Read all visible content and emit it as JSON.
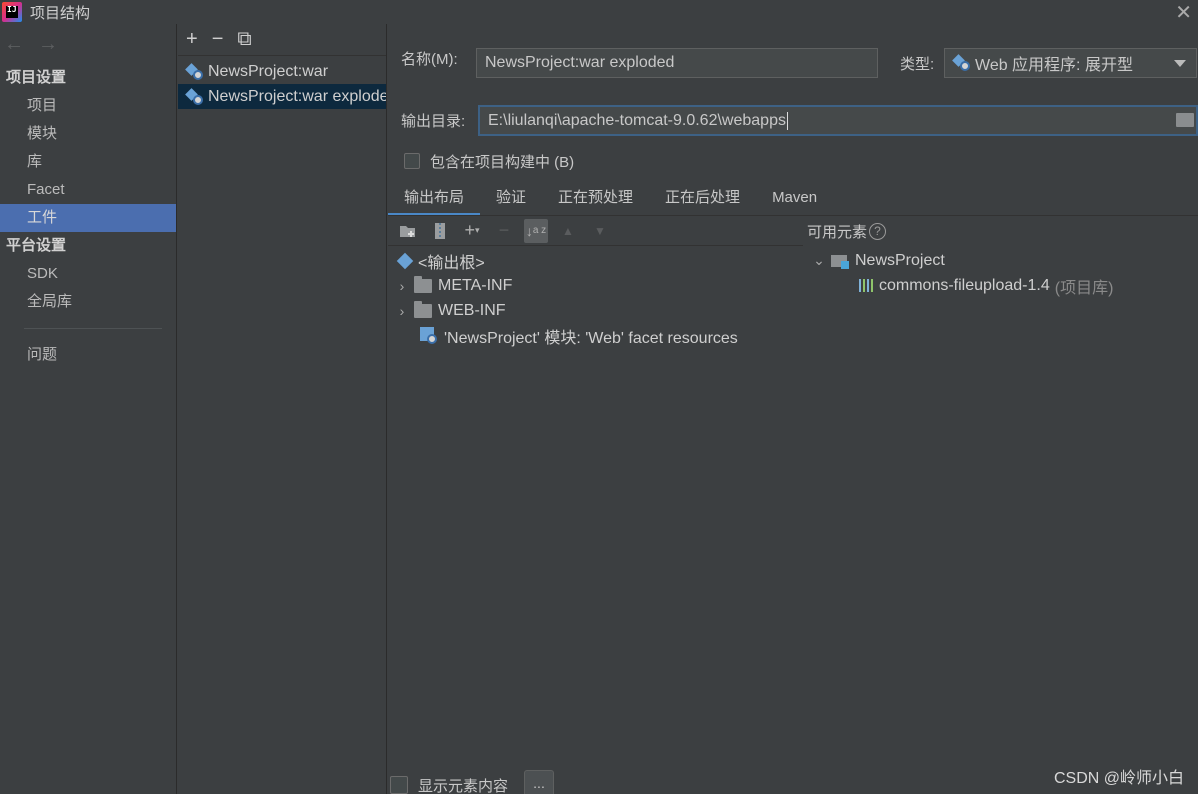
{
  "window": {
    "title": "项目结构",
    "app_icon_text": "IJ"
  },
  "nav": {
    "back": "←",
    "forward": "→",
    "project_settings": "项目设置",
    "project_items": [
      "项目",
      "模块",
      "库",
      "Facet",
      "工件"
    ],
    "platform_settings": "平台设置",
    "platform_items": [
      "SDK",
      "全局库"
    ],
    "problems": "问题"
  },
  "artifacts": {
    "toolbar": {
      "add": "+",
      "remove": "−",
      "copy": "⧉"
    },
    "items": [
      "NewsProject:war",
      "NewsProject:war exploded"
    ]
  },
  "form": {
    "name_label": "名称(M):",
    "name_value": "NewsProject:war exploded",
    "type_label": "类型:",
    "type_value": "Web 应用程序: 展开型",
    "output_label": "输出目录:",
    "output_value": "E:\\liulanqi\\apache-tomcat-9.0.62\\webapps",
    "include_in_build": "包含在项目构建中 (B)"
  },
  "tabs": [
    "输出布局",
    "验证",
    "正在预处理",
    "正在后处理",
    "Maven"
  ],
  "layout_tree": {
    "root": "<输出根>",
    "folders": [
      "META-INF",
      "WEB-INF"
    ],
    "facet_resources": "'NewsProject' 模块: 'Web' facet resources"
  },
  "available": {
    "title": "可用元素",
    "help": "?",
    "project": "NewsProject",
    "library_name": "commons-fileupload-1.4",
    "library_suffix": "(项目库)"
  },
  "bottom": {
    "show_content": "显示元素内容",
    "more": "..."
  },
  "watermark": "CSDN @岭师小白",
  "colors": {
    "selection": "#4b6eaf",
    "list_selection": "#0d293e",
    "focus_border": "#3d6185",
    "background": "#3c3f41"
  }
}
